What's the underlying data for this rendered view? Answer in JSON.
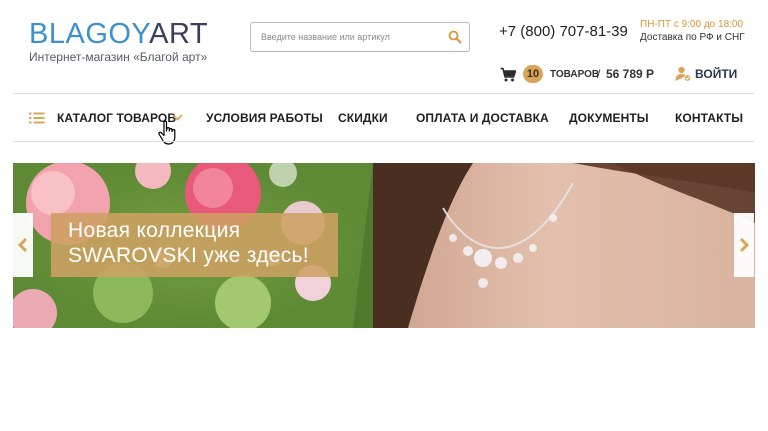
{
  "header": {
    "logo_part1": "BLAGOY",
    "logo_part2": "ART",
    "tagline": "Интернет-магазин «Благой арт»",
    "search_placeholder": "Введите название или артикул",
    "phone": "+7 (800) 707-81-39",
    "hours": "ПН-ПТ с 9:00 до 18:00",
    "delivery": "Доставка по РФ и СНГ",
    "cart": {
      "count": "10",
      "label": "ТОВАРОВ",
      "separator": "/",
      "sum": "56 789 Р"
    },
    "login_label": "ВОЙТИ"
  },
  "nav": {
    "catalog": "КАТАЛОГ ТОВАРОВ",
    "terms": "УСЛОВИЯ РАБОТЫ",
    "discounts": "СКИДКИ",
    "payment": "ОПЛАТА И ДОСТАВКА",
    "documents": "ДОКУМЕНТЫ",
    "contacts": "КОНТАКТЫ"
  },
  "banner": {
    "caption_line1": "Новая коллекция",
    "caption_line2": "SWAROVSKI уже здесь!"
  },
  "colors": {
    "accent": "#d9a55b",
    "logo_blue": "#3d8fd0",
    "logo_dark": "#3b3f58",
    "hours": "#d9953a"
  },
  "icons": [
    "search-icon",
    "cart-icon",
    "login-icon",
    "list-icon",
    "chevron-down-icon",
    "hand-cursor-icon",
    "arrow-left-icon",
    "arrow-right-icon"
  ]
}
